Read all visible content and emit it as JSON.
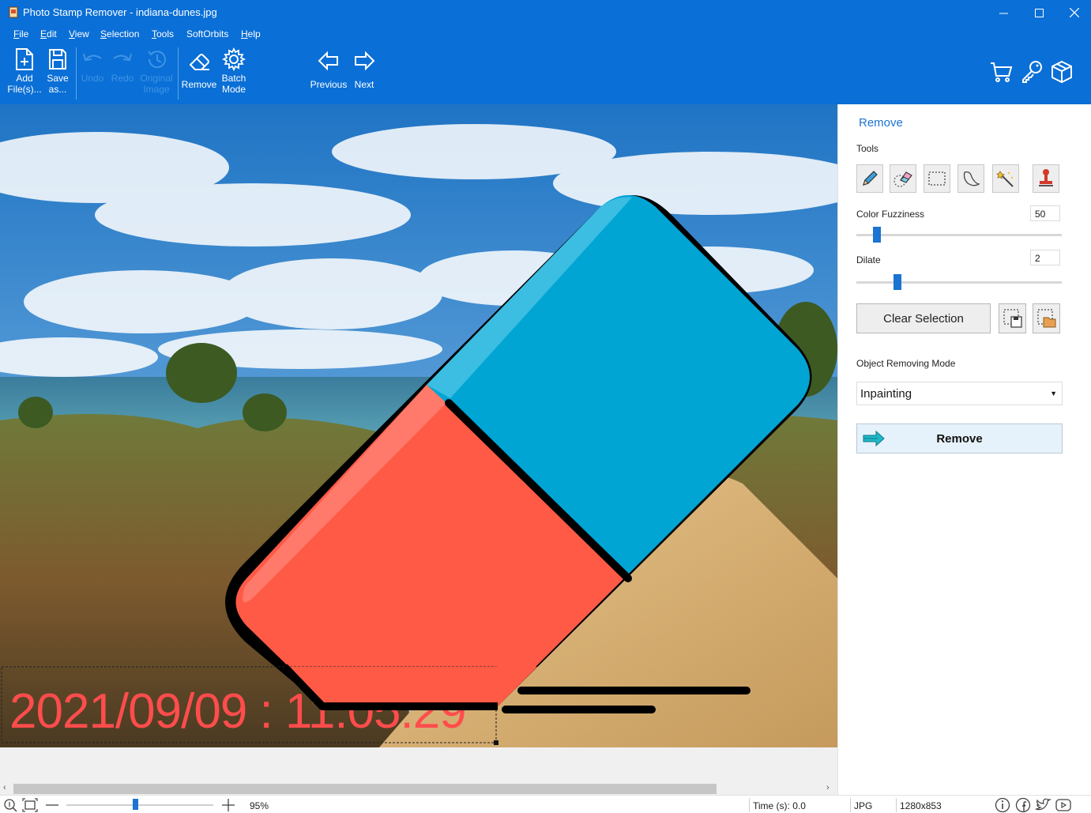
{
  "window": {
    "title": "Photo Stamp Remover - indiana-dunes.jpg"
  },
  "menu": [
    {
      "mnemonic": "F",
      "rest": "ile"
    },
    {
      "mnemonic": "E",
      "rest": "dit"
    },
    {
      "mnemonic": "V",
      "rest": "iew"
    },
    {
      "mnemonic": "S",
      "rest": "election"
    },
    {
      "mnemonic": "T",
      "rest": "ools"
    },
    {
      "mnemonic": "",
      "rest": "SoftOrbits"
    },
    {
      "mnemonic": "H",
      "rest": "elp"
    }
  ],
  "toolbar": {
    "add_l1": "Add",
    "add_l2": "File(s)...",
    "save_l1": "Save",
    "save_l2": "as...",
    "undo": "Undo",
    "redo": "Redo",
    "orig_l1": "Original",
    "orig_l2": "Image",
    "remove": "Remove",
    "batch_l1": "Batch",
    "batch_l2": "Mode",
    "previous": "Previous",
    "next": "Next"
  },
  "image": {
    "timestamp_visible": "2021/09/09 : 11:05:29"
  },
  "panel": {
    "title": "Remove",
    "tools_label": "Tools",
    "fuzziness_label": "Color Fuzziness",
    "fuzziness_value": "50",
    "fuzziness_level": 0.1,
    "dilate_label": "Dilate",
    "dilate_value": "2",
    "dilate_level": 0.2,
    "clear_selection": "Clear Selection",
    "mode_label": "Object Removing Mode",
    "mode_value": "Inpainting",
    "remove_button": "Remove"
  },
  "status": {
    "zoom": "95%",
    "time": "Time (s): 0.0",
    "format": "JPG",
    "dimensions": "1280x853"
  },
  "colors": {
    "accent": "#0a6fd6",
    "eraser_blue": "#00a5d4",
    "eraser_red": "#ff5a46",
    "timestamp": "#ff4c4c"
  }
}
